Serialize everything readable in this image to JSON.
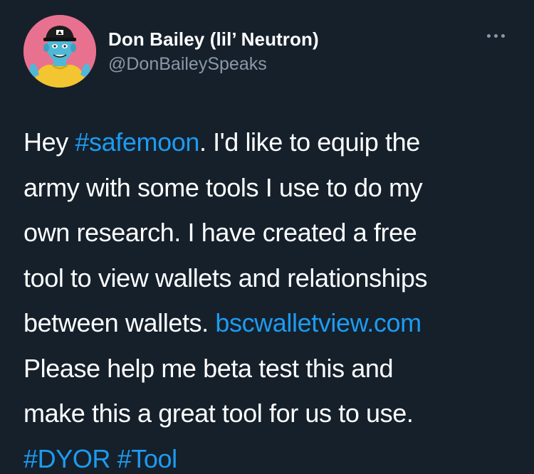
{
  "author": {
    "display_name": "Don Bailey (lil’ Neutron)",
    "handle": "@DonBaileySpeaks",
    "avatar_icon": "cartoon-avatar-icon"
  },
  "menu": {
    "more_icon": "more-options-icon"
  },
  "tweet": {
    "line1": {
      "t1": "Hey ",
      "hashtag": "#safemoon",
      "t2": ". I'd like to equip the"
    },
    "line2": "army with some tools I use to do my",
    "line3": "own research. I have created a free",
    "line4": "tool to view wallets and relationships",
    "line5": {
      "t1": "between wallets. ",
      "url": "bscwalletview.com"
    },
    "line6": "Please help me beta test this and",
    "line7": "make this a great tool for us to use.",
    "line8": {
      "hashtag1": "#DYOR",
      "sep": " ",
      "hashtag2": "#Tool"
    }
  },
  "colors": {
    "background": "#15202b",
    "link": "#1d9bf0",
    "secondary_text": "#8b98a5",
    "primary_text": "#ffffff"
  }
}
